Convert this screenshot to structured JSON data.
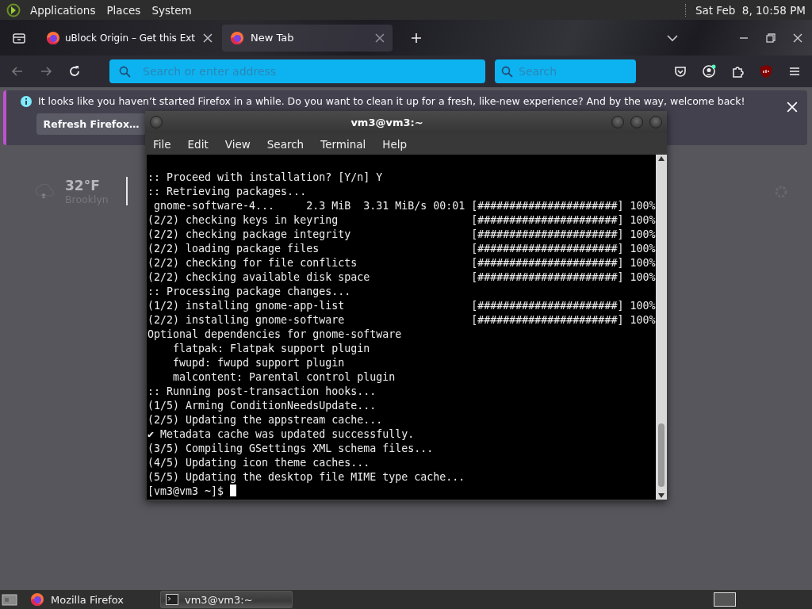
{
  "top_panel": {
    "menus": [
      "Applications",
      "Places",
      "System"
    ],
    "clock": "Sat Feb  8, 10:58 PM"
  },
  "browser": {
    "tabs": [
      {
        "title": "uBlock Origin – Get this Ext",
        "selected": false
      },
      {
        "title": "New Tab",
        "selected": true
      }
    ],
    "address_bar": {
      "placeholder": "Search or enter address"
    },
    "search_bar": {
      "placeholder": "Search"
    },
    "notification": {
      "text": "It looks like you haven’t started Firefox in a while. Do you want to clean it up for a fresh, like-new experience? And by the way, welcome back!",
      "button": "Refresh Firefox…"
    },
    "weather": {
      "temperature": "32°F",
      "location": "Brooklyn"
    }
  },
  "terminal": {
    "title": "vm3@vm3:~",
    "menus": [
      "File",
      "Edit",
      "View",
      "Search",
      "Terminal",
      "Help"
    ],
    "lines": [
      {
        "text": ":: Proceed with installation? [Y/n] Y"
      },
      {
        "text": ":: Retrieving packages..."
      },
      {
        "text": " gnome-software-4...     2.3 MiB  3.31 MiB/s 00:01",
        "progress": "[######################] 100%"
      },
      {
        "text": "(2/2) checking keys in keyring",
        "progress": "[######################] 100%"
      },
      {
        "text": "(2/2) checking package integrity",
        "progress": "[######################] 100%"
      },
      {
        "text": "(2/2) loading package files",
        "progress": "[######################] 100%"
      },
      {
        "text": "(2/2) checking for file conflicts",
        "progress": "[######################] 100%"
      },
      {
        "text": "(2/2) checking available disk space",
        "progress": "[######################] 100%"
      },
      {
        "text": ":: Processing package changes..."
      },
      {
        "text": "(1/2) installing gnome-app-list",
        "progress": "[######################] 100%"
      },
      {
        "text": "(2/2) installing gnome-software",
        "progress": "[######################] 100%"
      },
      {
        "text": "Optional dependencies for gnome-software"
      },
      {
        "text": "    flatpak: Flatpak support plugin"
      },
      {
        "text": "    fwupd: fwupd support plugin"
      },
      {
        "text": "    malcontent: Parental control plugin"
      },
      {
        "text": ":: Running post-transaction hooks..."
      },
      {
        "text": "(1/5) Arming ConditionNeedsUpdate..."
      },
      {
        "text": "(2/5) Updating the appstream cache..."
      },
      {
        "text": "✔ Metadata cache was updated successfully."
      },
      {
        "text": "(3/5) Compiling GSettings XML schema files..."
      },
      {
        "text": "(4/5) Updating icon theme caches..."
      },
      {
        "text": "(5/5) Updating the desktop file MIME type cache..."
      }
    ],
    "prompt": "[vm3@vm3 ~]$"
  },
  "taskbar": {
    "items": [
      {
        "label": "Mozilla Firefox",
        "kind": "browser",
        "selected": false
      },
      {
        "label": "vm3@vm3:~",
        "kind": "terminal",
        "selected": true
      }
    ]
  }
}
